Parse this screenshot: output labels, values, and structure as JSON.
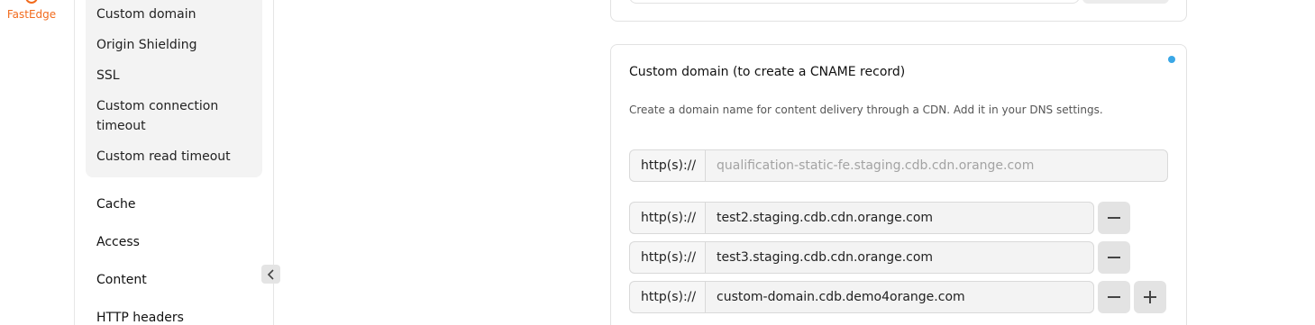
{
  "rail": {
    "brand_label": "FastEdge"
  },
  "nav": {
    "subitems": [
      "Custom domain",
      "Origin Shielding",
      "SSL",
      "Custom connection timeout",
      "Custom read timeout"
    ],
    "items": [
      "Cache",
      "Access",
      "Content",
      "HTTP headers"
    ],
    "collapse_icon": "chevron-left-icon"
  },
  "custom_domain_card": {
    "title": "Custom domain (to create a CNAME record)",
    "description": "Create a domain name for content delivery through a CDN. Add it in your DNS settings.",
    "prefix": "http(s)://",
    "primary_placeholder": "qualification-static-fe.staging.cdb.cdn.orange.com",
    "domains": [
      "test2.staging.cdb.cdn.orange.com",
      "test3.staging.cdb.cdn.orange.com",
      "custom-domain.cdb.demo4orange.com"
    ],
    "status_dot_color": "#3aa7e6"
  }
}
